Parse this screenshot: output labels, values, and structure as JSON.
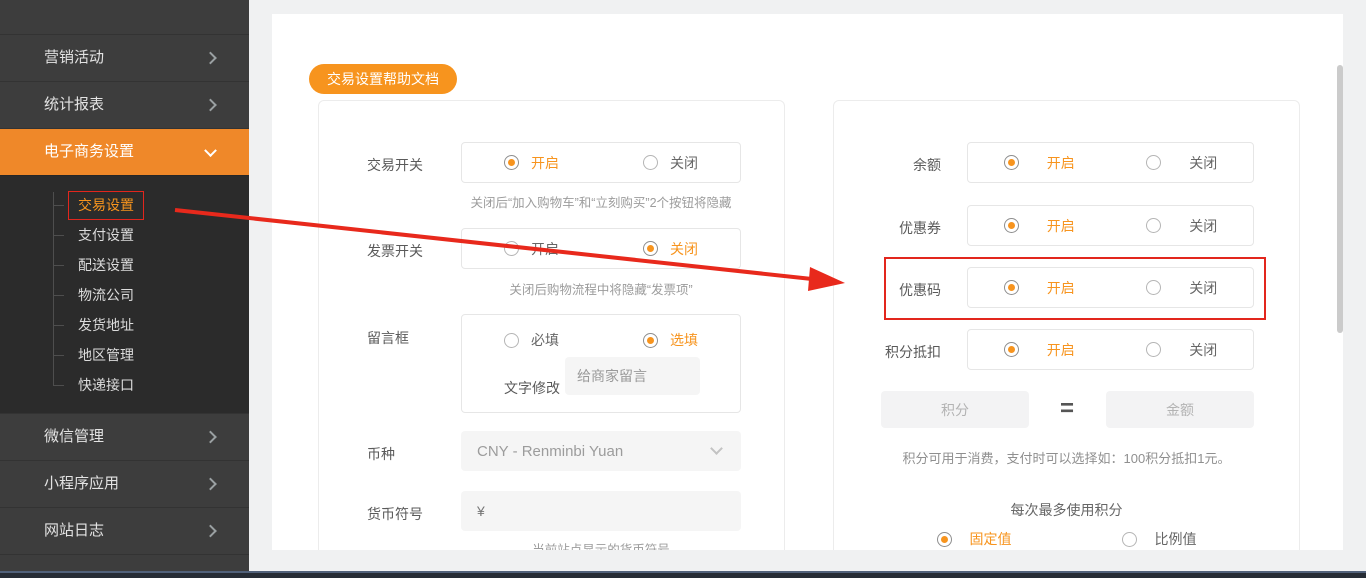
{
  "colors": {
    "accent_orange": "#f7941e",
    "sidebar_active_bg": "#ef8829",
    "annotation_red": "#e2261d"
  },
  "sidebar": {
    "top_items": [
      {
        "label": "营销活动"
      },
      {
        "label": "统计报表"
      },
      {
        "label": "电子商务设置"
      }
    ],
    "submenu": [
      {
        "label": "交易设置"
      },
      {
        "label": "支付设置"
      },
      {
        "label": "配送设置"
      },
      {
        "label": "物流公司"
      },
      {
        "label": "发货地址"
      },
      {
        "label": "地区管理"
      },
      {
        "label": "快递接口"
      }
    ],
    "bottom_items": [
      {
        "label": "微信管理"
      },
      {
        "label": "小程序应用"
      },
      {
        "label": "网站日志"
      }
    ]
  },
  "header": {
    "help_button": "交易设置帮助文档"
  },
  "trade_panel": {
    "trade_switch": {
      "label": "交易开关",
      "on": "开启",
      "off": "关闭",
      "selected": "开启",
      "note": "关闭后“加入购物车”和“立刻购买”2个按钮将隐藏"
    },
    "invoice_switch": {
      "label": "发票开关",
      "on": "开启",
      "off": "关闭",
      "selected": "关闭",
      "note": "关闭后购物流程中将隐藏“发票项”"
    },
    "message_box": {
      "label": "留言框",
      "required": "必填",
      "optional": "选填",
      "selected": "选填",
      "modify_label": "文字修改",
      "placeholder": "给商家留言"
    },
    "currency": {
      "label": "币种",
      "value": "CNY - Renminbi Yuan"
    },
    "currency_symbol": {
      "label": "货币符号",
      "value": "¥",
      "note": "当前站点显示的货币符号"
    }
  },
  "promo_panel": {
    "balance": {
      "label": "余额",
      "on": "开启",
      "off": "关闭",
      "selected": "开启"
    },
    "coupon": {
      "label": "优惠券",
      "on": "开启",
      "off": "关闭",
      "selected": "开启"
    },
    "coupon_code": {
      "label": "优惠码",
      "on": "开启",
      "off": "关闭",
      "selected": "开启"
    },
    "points_deduct": {
      "label": "积分抵扣",
      "on": "开启",
      "off": "关闭",
      "selected": "开启"
    },
    "points_ratio": {
      "points_placeholder": "积分",
      "equals": "=",
      "amount_placeholder": "金额",
      "note": "积分可用于消费，支付时可以选择如：100积分抵扣1元。"
    },
    "max_points": {
      "title": "每次最多使用积分",
      "fixed": "固定值",
      "ratio": "比例值",
      "selected": "固定值"
    }
  }
}
